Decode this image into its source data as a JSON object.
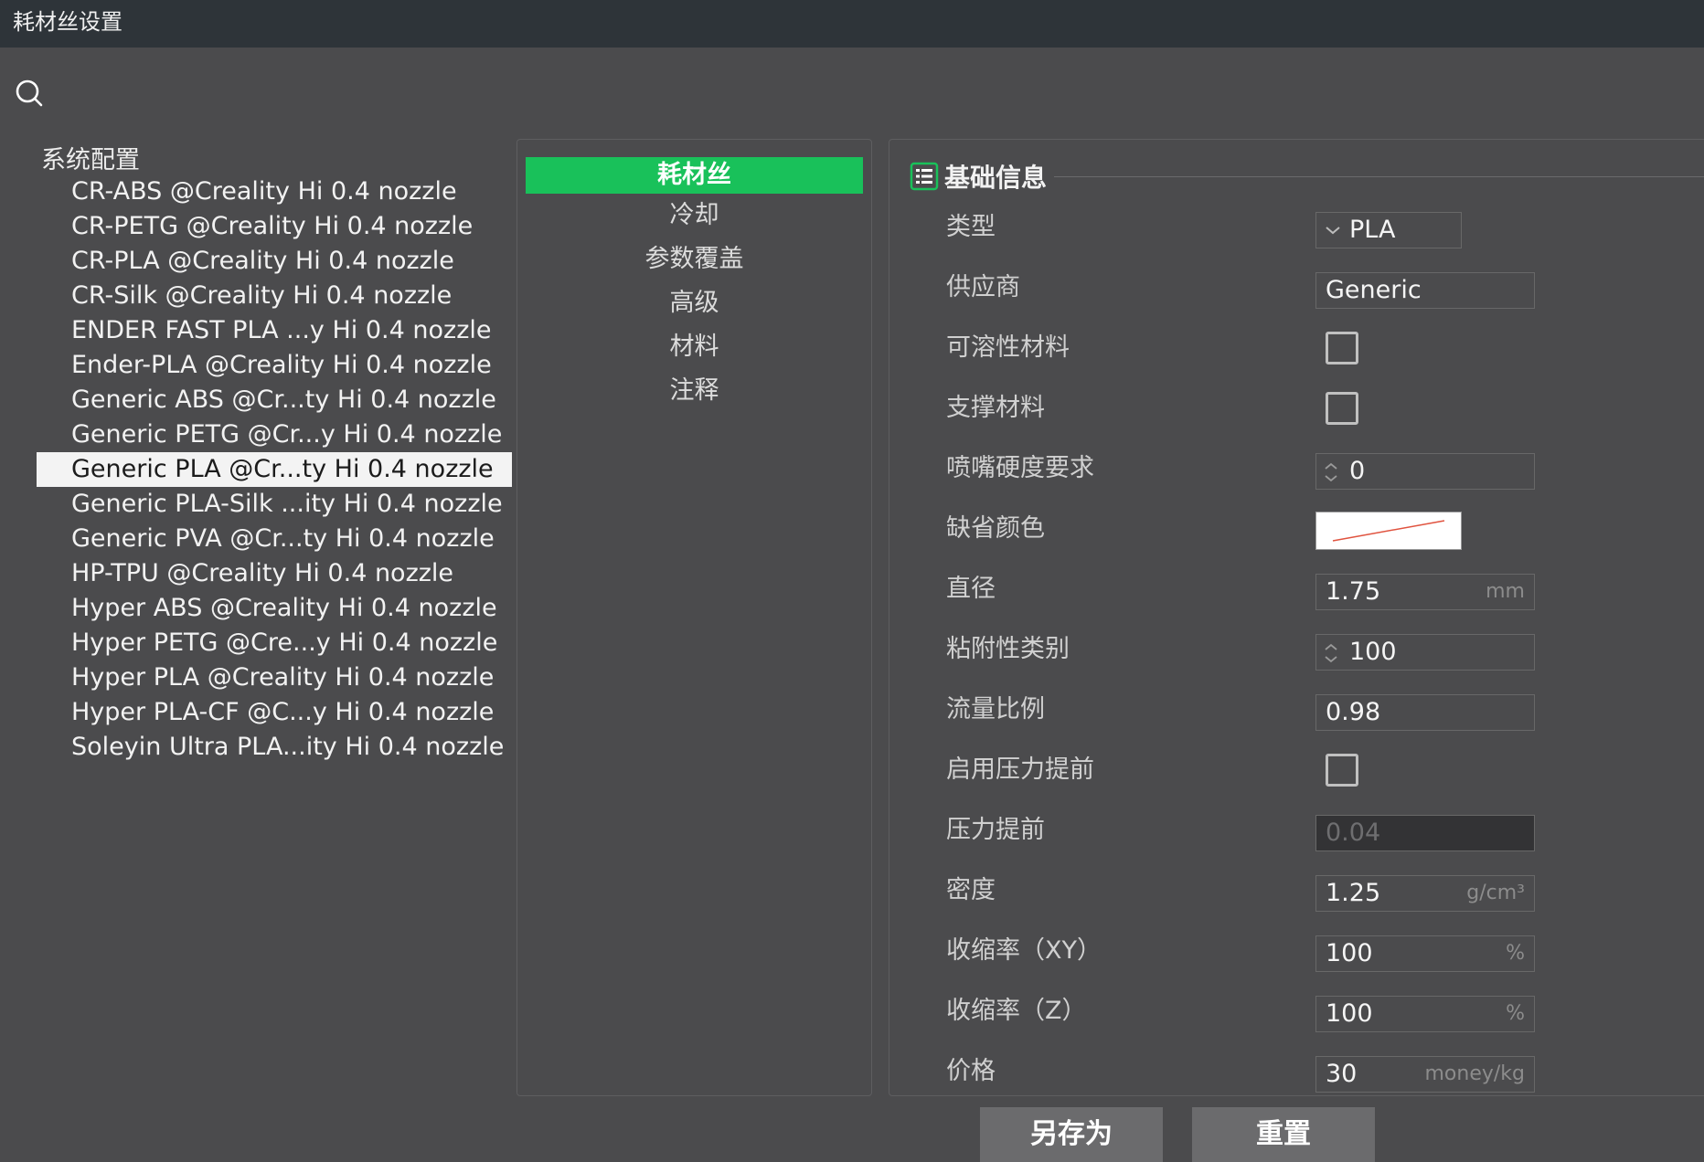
{
  "window": {
    "title": "耗材丝设置"
  },
  "presets": {
    "group_label": "系统配置",
    "items": [
      {
        "label": "CR-ABS @Creality Hi 0.4 nozzle"
      },
      {
        "label": "CR-PETG @Creality Hi 0.4 nozzle"
      },
      {
        "label": "CR-PLA @Creality Hi 0.4 nozzle"
      },
      {
        "label": "CR-Silk @Creality Hi 0.4 nozzle"
      },
      {
        "label": "ENDER FAST PLA ...y Hi 0.4 nozzle"
      },
      {
        "label": "Ender-PLA @Creality Hi 0.4 nozzle"
      },
      {
        "label": "Generic ABS @Cr...ty Hi 0.4 nozzle"
      },
      {
        "label": "Generic PETG @Cr...y Hi 0.4 nozzle"
      },
      {
        "label": "Generic PLA @Cr...ty Hi 0.4 nozzle",
        "selected": true
      },
      {
        "label": "Generic PLA-Silk ...ity Hi 0.4 nozzle"
      },
      {
        "label": "Generic PVA @Cr...ty Hi 0.4 nozzle"
      },
      {
        "label": "HP-TPU @Creality Hi 0.4 nozzle"
      },
      {
        "label": "Hyper ABS @Creality Hi 0.4 nozzle"
      },
      {
        "label": "Hyper PETG @Cre...y Hi 0.4 nozzle"
      },
      {
        "label": "Hyper PLA @Creality Hi 0.4 nozzle"
      },
      {
        "label": "Hyper PLA-CF @C...y Hi 0.4 nozzle"
      },
      {
        "label": "Soleyin Ultra PLA...ity Hi 0.4 nozzle"
      }
    ]
  },
  "nav": {
    "tabs": [
      {
        "label": "耗材丝",
        "active": true
      },
      {
        "label": "冷却"
      },
      {
        "label": "参数覆盖"
      },
      {
        "label": "高级"
      },
      {
        "label": "材料"
      },
      {
        "label": "注释"
      }
    ]
  },
  "settings": {
    "section_title": "基础信息",
    "section_icon": "list-icon",
    "fields": {
      "type": {
        "label": "类型",
        "value": "PLA"
      },
      "vendor": {
        "label": "供应商",
        "value": "Generic"
      },
      "soluble": {
        "label": "可溶性材料",
        "checked": false
      },
      "support": {
        "label": "支撑材料",
        "checked": false
      },
      "nozzle_hardness": {
        "label": "喷嘴硬度要求",
        "value": "0"
      },
      "default_color": {
        "label": "缺省颜色",
        "color": "#ffffff"
      },
      "diameter": {
        "label": "直径",
        "value": "1.75",
        "unit": "mm"
      },
      "adhesion": {
        "label": "粘附性类别",
        "value": "100"
      },
      "flow_ratio": {
        "label": "流量比例",
        "value": "0.98"
      },
      "enable_pa": {
        "label": "启用压力提前",
        "checked": false
      },
      "pressure_advance": {
        "label": "压力提前",
        "value": "0.04"
      },
      "density": {
        "label": "密度",
        "value": "1.25",
        "unit": "g/cm³"
      },
      "shrink_xy": {
        "label": "收缩率（XY）",
        "value": "100",
        "unit": "%"
      },
      "shrink_z": {
        "label": "收缩率（Z）",
        "value": "100",
        "unit": "%"
      },
      "price": {
        "label": "价格",
        "value": "30",
        "unit": "money/kg"
      }
    }
  },
  "buttons": {
    "save_as": "另存为",
    "reset": "重置"
  },
  "colors": {
    "accent": "#19c15a",
    "background": "#4b4b4d",
    "titlebar": "#2e3439"
  }
}
